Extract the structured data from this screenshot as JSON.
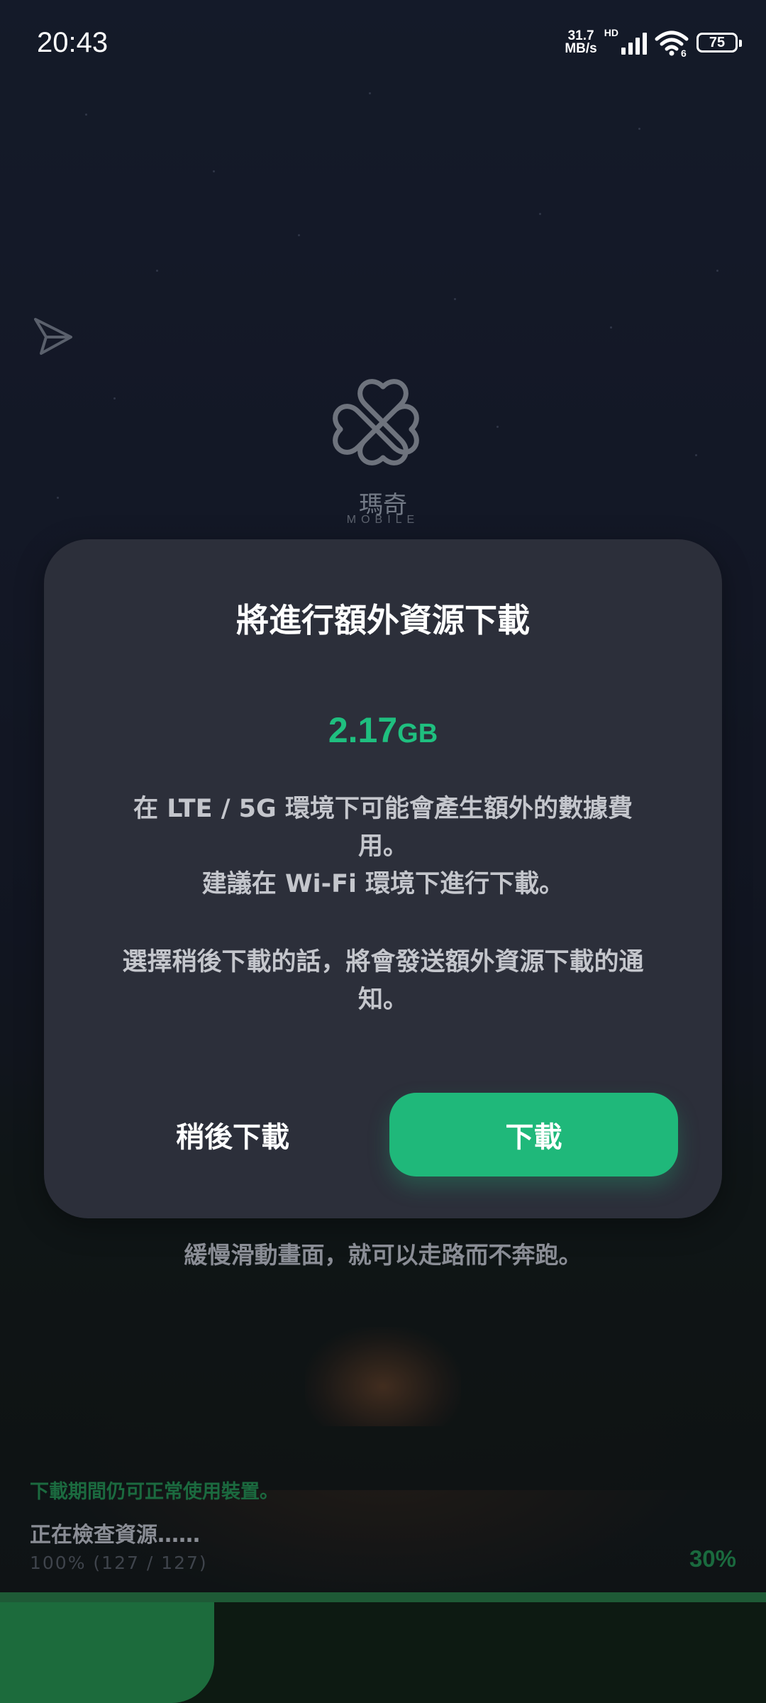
{
  "status_bar": {
    "time": "20:43",
    "network_speed_value": "31.7",
    "network_speed_unit": "MB/s",
    "hd_label": "HD",
    "wifi_label": "6",
    "battery": "75"
  },
  "logo": {
    "name_cn": "瑪奇",
    "name_en": "MOBILE"
  },
  "dialog": {
    "title": "將進行額外資源下載",
    "size_value": "2.17",
    "size_unit": "GB",
    "body_line1": "在 LTE / 5G 環境下可能會產生額外的數據費",
    "body_line2": "用。",
    "body_line3": "建議在 Wi-Fi 環境下進行下載。",
    "body_line4": "選擇稍後下載的話，將會發送額外資源下載的通",
    "body_line5": "知。",
    "later_button": "稍後下載",
    "download_button": "下載"
  },
  "tip": "緩慢滑動畫面，就可以走路而不奔跑。",
  "loading": {
    "note": "下載期間仍可正常使用裝置。",
    "status": "正在檢查資源……",
    "counter": "100% (127 / 127)",
    "percent_text": "30%",
    "progress_fraction": 0.28
  },
  "colors": {
    "accent": "#1fb87a",
    "dialog_bg": "#2c2f3a"
  }
}
